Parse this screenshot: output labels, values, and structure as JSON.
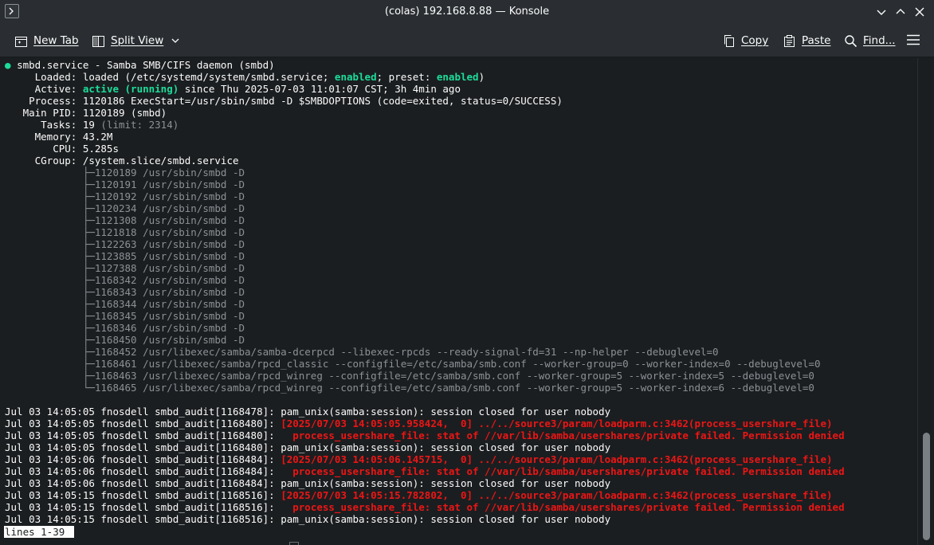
{
  "window": {
    "title": "(colas) 192.168.8.88 — Konsole",
    "app_icon": "terminal-prompt-icon",
    "controls": [
      "chevron-down-icon",
      "chevron-up-icon",
      "close-icon"
    ]
  },
  "toolbar": {
    "new_tab": "New Tab",
    "split_view": "Split View",
    "copy": "Copy",
    "paste": "Paste",
    "find": "Find...",
    "menu_icon": "hamburger-menu-icon"
  },
  "colors": {
    "background": "#1b1e20",
    "green": "#1cdc9a",
    "red": "#ed1515",
    "gray": "#8c9196"
  },
  "service": {
    "header": "smbd.service - Samba SMB/CIFS daemon (smbd)",
    "loaded_key": "     Loaded: ",
    "loaded_a": "loaded (/etc/systemd/system/smbd.service; ",
    "loaded_enabled": "enabled",
    "loaded_b": "; preset: ",
    "loaded_preset": "enabled",
    "loaded_c": ")",
    "active_key": "     Active: ",
    "active_state": "active (running)",
    "active_rest": " since Thu 2025-07-03 11:01:07 CST; 3h 4min ago",
    "process": "    Process: 1120186 ExecStart=/usr/sbin/smbd -D $SMBDOPTIONS (code=exited, status=0/SUCCESS)",
    "main_pid": "   Main PID: 1120189 (smbd)",
    "tasks_key": "      Tasks: 19 ",
    "tasks_limit": "(limit: 2314)",
    "memory": "     Memory: 43.2M",
    "cpu": "        CPU: 5.285s",
    "cgroup": "     CGroup: /system.slice/smbd.service"
  },
  "cgroup_tree": [
    "             ├─1120189 /usr/sbin/smbd -D",
    "             ├─1120191 /usr/sbin/smbd -D",
    "             ├─1120192 /usr/sbin/smbd -D",
    "             ├─1120234 /usr/sbin/smbd -D",
    "             ├─1121308 /usr/sbin/smbd -D",
    "             ├─1121818 /usr/sbin/smbd -D",
    "             ├─1122263 /usr/sbin/smbd -D",
    "             ├─1123885 /usr/sbin/smbd -D",
    "             ├─1127388 /usr/sbin/smbd -D",
    "             ├─1168342 /usr/sbin/smbd -D",
    "             ├─1168343 /usr/sbin/smbd -D",
    "             ├─1168344 /usr/sbin/smbd -D",
    "             ├─1168345 /usr/sbin/smbd -D",
    "             ├─1168346 /usr/sbin/smbd -D",
    "             ├─1168450 /usr/sbin/smbd -D",
    "             ├─1168452 /usr/libexec/samba/samba-dcerpcd --libexec-rpcds --ready-signal-fd=31 --np-helper --debuglevel=0",
    "             ├─1168461 /usr/libexec/samba/rpcd_classic --configfile=/etc/samba/smb.conf --worker-group=0 --worker-index=0 --debuglevel=0",
    "             ├─1168463 /usr/libexec/samba/rpcd_winreg --configfile=/etc/samba/smb.conf --worker-group=5 --worker-index=5 --debuglevel=0",
    "             └─1168465 /usr/libexec/samba/rpcd_winreg --configfile=/etc/samba/smb.conf --worker-group=5 --worker-index=6 --debuglevel=0"
  ],
  "log": [
    {
      "prefix": "Jul 03 14:05:05 fnosdell smbd_audit[1168478]: ",
      "text": "pam_unix(samba:session): session closed for user nobody",
      "err": false
    },
    {
      "prefix": "Jul 03 14:05:05 fnosdell smbd_audit[1168480]: ",
      "text": "[2025/07/03 14:05:05.958424,  0] ../../source3/param/loadparm.c:3462(process_usershare_file)",
      "err": true
    },
    {
      "prefix": "Jul 03 14:05:05 fnosdell smbd_audit[1168480]: ",
      "text": "  process_usershare_file: stat of //var/lib/samba/usershares/private failed. Permission denied",
      "err": true
    },
    {
      "prefix": "Jul 03 14:05:05 fnosdell smbd_audit[1168480]: ",
      "text": "pam_unix(samba:session): session closed for user nobody",
      "err": false
    },
    {
      "prefix": "Jul 03 14:05:06 fnosdell smbd_audit[1168484]: ",
      "text": "[2025/07/03 14:05:06.145715,  0] ../../source3/param/loadparm.c:3462(process_usershare_file)",
      "err": true
    },
    {
      "prefix": "Jul 03 14:05:06 fnosdell smbd_audit[1168484]: ",
      "text": "  process_usershare_file: stat of //var/lib/samba/usershares/private failed. Permission denied",
      "err": true
    },
    {
      "prefix": "Jul 03 14:05:06 fnosdell smbd_audit[1168484]: ",
      "text": "pam_unix(samba:session): session closed for user nobody",
      "err": false
    },
    {
      "prefix": "Jul 03 14:05:15 fnosdell smbd_audit[1168516]: ",
      "text": "[2025/07/03 14:05:15.782802,  0] ../../source3/param/loadparm.c:3462(process_usershare_file)",
      "err": true
    },
    {
      "prefix": "Jul 03 14:05:15 fnosdell smbd_audit[1168516]: ",
      "text": "  process_usershare_file: stat of //var/lib/samba/usershares/private failed. Permission denied",
      "err": true
    },
    {
      "prefix": "Jul 03 14:05:15 fnosdell smbd_audit[1168516]: ",
      "text": "pam_unix(samba:session): session closed for user nobody",
      "err": false
    }
  ],
  "pager_status": "lines 1-39"
}
